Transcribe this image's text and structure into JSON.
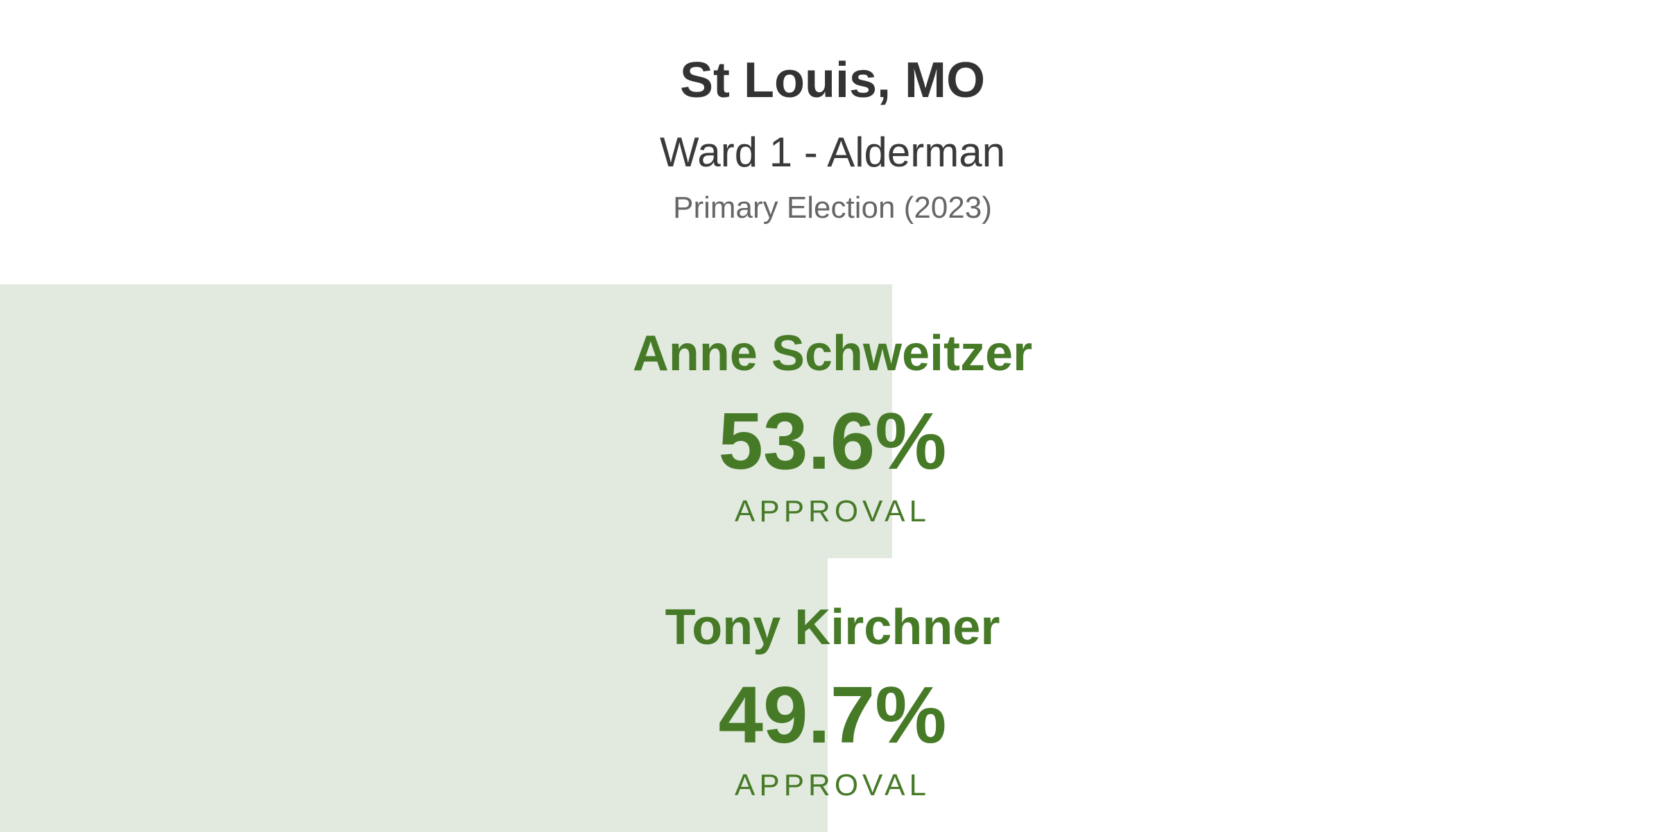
{
  "header": {
    "city": "St Louis, MO",
    "office": "Ward 1 - Alderman",
    "election": "Primary Election (2023)"
  },
  "candidates": [
    {
      "name": "Anne Schweitzer",
      "percent_label": "53.6%",
      "percent_value": 53.6,
      "metric_label": "APPROVAL",
      "color": "#467a27"
    },
    {
      "name": "Tony Kirchner",
      "percent_label": "49.7%",
      "percent_value": 49.7,
      "metric_label": "APPROVAL",
      "color": "#467a27"
    }
  ],
  "colors": {
    "title": "#333333",
    "subtitle": "#3a3a3a",
    "muted": "#666666",
    "bar": "#e2eadf",
    "accent": "#467a27"
  }
}
